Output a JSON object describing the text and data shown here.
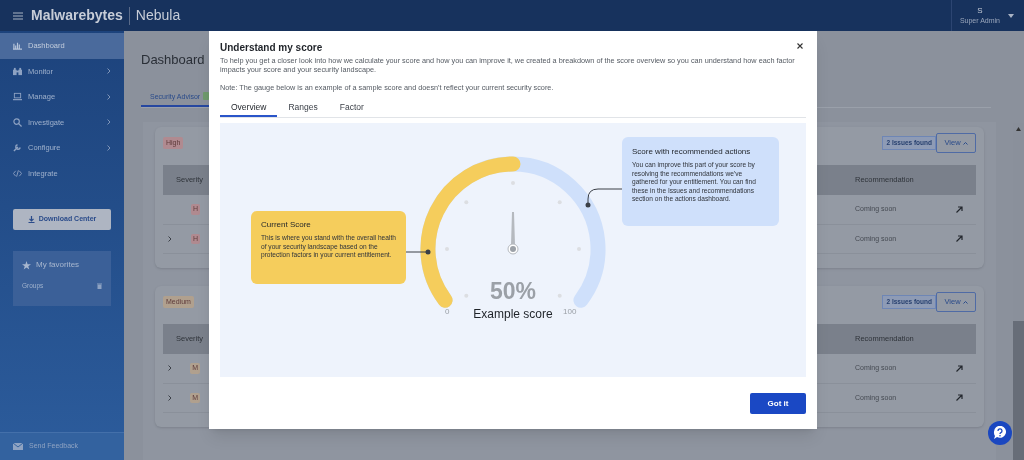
{
  "header": {
    "product": "Malwarebytes",
    "app": "Nebula",
    "user": "S",
    "role": "Super Admin"
  },
  "sidebar": {
    "items": [
      {
        "label": "Dashboard",
        "selected": true,
        "has_submenu": false
      },
      {
        "label": "Monitor",
        "selected": false,
        "has_submenu": true
      },
      {
        "label": "Manage",
        "selected": false,
        "has_submenu": true
      },
      {
        "label": "Investigate",
        "selected": false,
        "has_submenu": true
      },
      {
        "label": "Configure",
        "selected": false,
        "has_submenu": true
      },
      {
        "label": "Integrate",
        "selected": false,
        "has_submenu": false
      }
    ],
    "download_button": "Download Center",
    "favorites": {
      "title": "My favorites",
      "items": [
        "Groups"
      ]
    },
    "feedback": "Send Feedback"
  },
  "page": {
    "title": "Dashboard",
    "tabs": [
      {
        "label": "Security Advisor",
        "selected": true
      }
    ],
    "sections": [
      {
        "severity": "High",
        "color": "#b08a90",
        "issues": "2 Issues found",
        "view": "View",
        "columns": [
          "Severity",
          "Recommendation"
        ],
        "rows": [
          {
            "expandable": false,
            "badge": "H",
            "recommendation": "Coming soon"
          },
          {
            "expandable": true,
            "badge": "H",
            "recommendation": "Coming soon"
          }
        ]
      },
      {
        "severity": "Medium",
        "color": "#b0a08e",
        "issues": "2 Issues found",
        "view": "View",
        "columns": [
          "Severity",
          "Recommendation"
        ],
        "rows": [
          {
            "expandable": true,
            "badge": "M",
            "recommendation": "Coming soon"
          },
          {
            "expandable": true,
            "badge": "M",
            "recommendation": "Coming soon"
          }
        ]
      }
    ]
  },
  "modal": {
    "title": "Understand my score",
    "description": "To help you get a closer look into how we calculate your score and how you can improve it, we created a breakdown of the score overview so you can understand how each factor impacts your score and your security landscape.",
    "note": "Note: The gauge below is an example of a sample score and doesn't reflect your current security score.",
    "tabs": [
      {
        "label": "Overview",
        "selected": true
      },
      {
        "label": "Ranges",
        "selected": false
      },
      {
        "label": "Factor",
        "selected": false
      }
    ],
    "gauge": {
      "level": 0.5,
      "value": "50%",
      "caption": "Example score",
      "min": "0",
      "max": "100"
    },
    "callouts": [
      {
        "title": "Current Score",
        "text": "This is where you stand with the overall health of your security landscape based on the protection factors in your current entitlement."
      },
      {
        "title": "Score with recommended actions",
        "text": "You can improve this part of your score by resolving the recommendations we've gathered for your entitlement. You can find these in the Issues and recommendations section on the actions dashboard."
      }
    ],
    "button": "Got it"
  }
}
